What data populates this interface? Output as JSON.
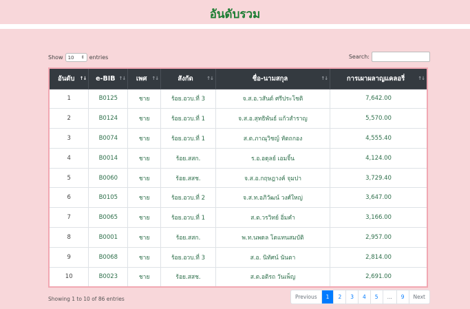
{
  "page": {
    "title": "อันดับรวม"
  },
  "controls": {
    "show_label": "Show",
    "entries_value": "10",
    "entries_label": "entries",
    "search_label": "Search:",
    "search_value": ""
  },
  "table": {
    "headers": [
      "อันดับ",
      "e-BIB",
      "เพศ",
      "สังกัด",
      "ชื่อ-นามสกุล",
      "การเผาผลาญแคลอรี่"
    ],
    "rows": [
      [
        "1",
        "B0125",
        "ชาย",
        "ร้อย.อวบ.ที่ 3",
        "จ.ส.อ.วสันต์ ศรีประโชติ",
        "7,642.00"
      ],
      [
        "2",
        "B0124",
        "ชาย",
        "ร้อย.อวบ.ที่ 1",
        "จ.ส.อ.สุทธิพันธ์ แก้วสำราญ",
        "5,570.00"
      ],
      [
        "3",
        "B0074",
        "ชาย",
        "ร้อย.อวบ.ที่ 1",
        "ส.ต.ภาณุวิชญ์ หัตถกอง",
        "4,555.40"
      ],
      [
        "4",
        "B0014",
        "ชาย",
        "ร้อย.สสก.",
        "ร.อ.อดุลย์ เอมจิ้น",
        "4,124.00"
      ],
      [
        "5",
        "B0060",
        "ชาย",
        "ร้อย.สสช.",
        "จ.ส.อ.กฤษฎางค์ จุมปา",
        "3,729.40"
      ],
      [
        "6",
        "B0105",
        "ชาย",
        "ร้อย.อวบ.ที่ 2",
        "จ.ส.ท.อภิวัฒน์ วงศ์ใหญ่",
        "3,647.00"
      ],
      [
        "7",
        "B0065",
        "ชาย",
        "ร้อย.อวบ.ที่ 1",
        "ส.ต.วรวิทย์ อิ่มคำ",
        "3,166.00"
      ],
      [
        "8",
        "B0001",
        "ชาย",
        "ร้อย.สสก.",
        "พ.ท.นพดล โตแทนสมบัติ",
        "2,957.00"
      ],
      [
        "9",
        "B0068",
        "ชาย",
        "ร้อย.อวบ.ที่ 3",
        "ส.อ. นิทัศน์ นันตา",
        "2,814.00"
      ],
      [
        "10",
        "B0023",
        "ชาย",
        "ร้อย.สสช.",
        "ส.ต.อติรถ วันเพ็ญ",
        "2,691.00"
      ]
    ]
  },
  "footer": {
    "info": "Showing 1 to 10 of 86 entries"
  },
  "pagination": {
    "items": [
      "Previous",
      "1",
      "2",
      "3",
      "4",
      "5",
      "...",
      "9",
      "Next"
    ],
    "active": "1"
  },
  "colors": {
    "background": "#f8d7da",
    "title": "#1e7e34",
    "header_bg": "#343a40",
    "active_page": "#007bff"
  }
}
